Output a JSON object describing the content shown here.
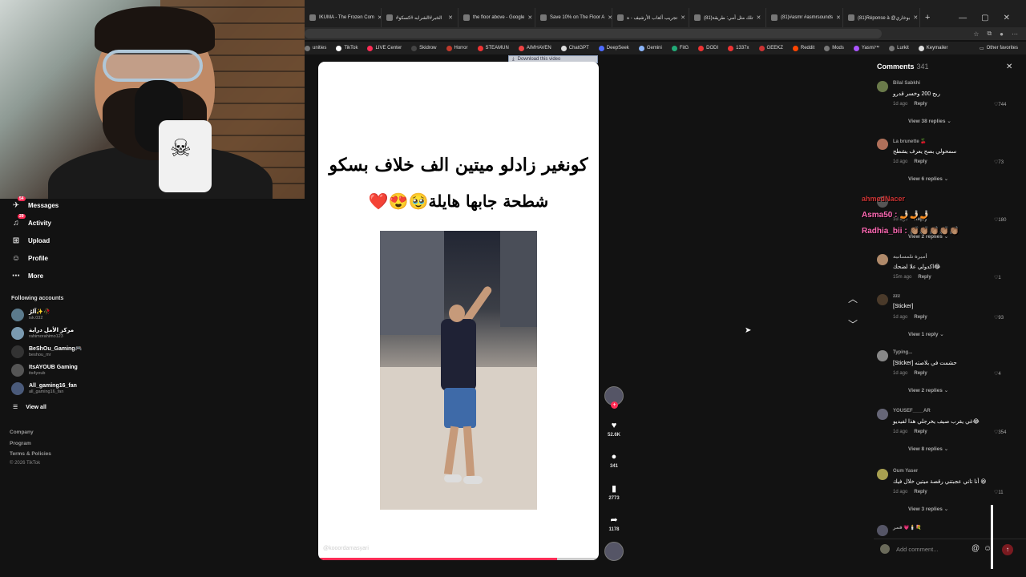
{
  "browser": {
    "tabs": [
      {
        "title": "IKUMA - The Frozen Com"
      },
      {
        "title": "#الخبر#الشرابه #كسكو"
      },
      {
        "title": "the floor above - Google"
      },
      {
        "title": "Save 10% on The Floor A"
      },
      {
        "title": "تجريب ألعاب الأرشيف - ه"
      },
      {
        "title": "(81)تلك مثل أمي: طريقة"
      },
      {
        "title": "(81)#asmr #asmrsounds"
      },
      {
        "title": "(81)Réponse à @بوخاري"
      }
    ],
    "window_controls": [
      "—",
      "▢",
      "✕"
    ],
    "bookmarks": [
      {
        "label": "unities",
        "color": "#777"
      },
      {
        "label": "TikTok",
        "color": "#fff"
      },
      {
        "label": "LIVE Center",
        "color": "#fe2c55"
      },
      {
        "label": "Skidrow",
        "color": "#444"
      },
      {
        "label": "Horror",
        "color": "#c0392b"
      },
      {
        "label": "STEAMUN",
        "color": "#e33"
      },
      {
        "label": "AIMHAVEN",
        "color": "#e44"
      },
      {
        "label": "ChatGPT",
        "color": "#ddd"
      },
      {
        "label": "DeepSeek",
        "color": "#4d6bfe"
      },
      {
        "label": "Gemini",
        "color": "#8ab4f8"
      },
      {
        "label": "FitG",
        "color": "#2a7"
      },
      {
        "label": "DODI",
        "color": "#e33"
      },
      {
        "label": "1337x",
        "color": "#e33"
      },
      {
        "label": "GEEKZ",
        "color": "#c33"
      },
      {
        "label": "Reddit",
        "color": "#ff4500"
      },
      {
        "label": "Mods",
        "color": "#777"
      },
      {
        "label": "Yasmi™",
        "color": "#a5f"
      },
      {
        "label": "Lurkit",
        "color": "#777"
      },
      {
        "label": "Keymailer",
        "color": "#ddd"
      }
    ],
    "other_favorites": "Other favorites"
  },
  "sidebar": {
    "nav": [
      {
        "label": "Messages",
        "icon": "paper-plane-icon",
        "glyph": "✈",
        "badge": "54"
      },
      {
        "label": "Activity",
        "icon": "bell-icon",
        "glyph": "♫",
        "badge": "29"
      },
      {
        "label": "Upload",
        "icon": "upload-icon",
        "glyph": "⊞",
        "badge": ""
      },
      {
        "label": "Profile",
        "icon": "profile-icon",
        "glyph": "☺",
        "badge": ""
      },
      {
        "label": "More",
        "icon": "more-icon",
        "glyph": "⋯",
        "badge": ""
      }
    ],
    "following_title": "Following accounts",
    "accounts": [
      {
        "name": "آلرُ✨🥀",
        "handle": "isk.032",
        "color": "#5b7a8c"
      },
      {
        "name": "مركز الأمل دراية",
        "handle": "rahimorahimo123",
        "color": "#7a9ab0"
      },
      {
        "name": "BeShOu_Gaming🎮",
        "handle": "beshou_mr",
        "color": "#333"
      },
      {
        "name": "ItsAYOUB Gaming",
        "handle": "its4youb",
        "color": "#555"
      },
      {
        "name": "All_gaming16_fan",
        "handle": "all_gaming16_fan",
        "color": "#4a5a7a"
      }
    ],
    "view_all": "View all",
    "footer": [
      "Company",
      "Program",
      "Terms & Policies"
    ],
    "copyright": "© 2026 TikTok"
  },
  "video": {
    "download_chip": "Download this video",
    "caption_line1": "كونغير زادلو ميتين الف خلاف بسكو",
    "caption_line2": "شطحة جابها هايلة🥹😍❤️",
    "watermark": "@kooordamasyari",
    "progress": 0.85
  },
  "actions": {
    "likes": "52.6K",
    "comments": "341",
    "saves": "2773",
    "shares": "1178"
  },
  "comments": {
    "title": "Comments",
    "count": "341",
    "items": [
      {
        "user": "Bilal Sabkhi",
        "text": "ربح 200 وخسر قدرو",
        "time": "1d ago",
        "likes": "744",
        "view_replies": "View 38 replies",
        "color": "#6a7a4a"
      },
      {
        "user": "La brunette 🍒",
        "text": "سمحولي بصح يعرف يشطح",
        "time": "1d ago",
        "likes": "73",
        "view_replies": "View 6 replies",
        "color": "#b0705a"
      },
      {
        "user": "",
        "text": "",
        "time": "1d ago",
        "likes": "180",
        "view_replies": "View 2 replies",
        "color": "#555"
      },
      {
        "user": "أميرة تلمسانية",
        "text": "اكدولي علا لضحك😂",
        "time": "15m ago",
        "likes": "1",
        "view_replies": "",
        "color": "#b08a6a"
      },
      {
        "user": "zzz",
        "text": "[Sticker]",
        "time": "1d ago",
        "likes": "93",
        "view_replies": "View 1 reply",
        "color": "#4a3a2a"
      },
      {
        "user": "Typing...",
        "text": "[Sticker] حشمت في بلاصته",
        "time": "1d ago",
        "likes": "4",
        "view_replies": "View 2 replies",
        "color": "#888"
      },
      {
        "user": "YOUSEF____AR",
        "text": "غي يقرب صيف يخرجلي هذا لفيديو😂",
        "time": "1d ago",
        "likes": "354",
        "view_replies": "View 8 replies",
        "color": "#667"
      },
      {
        "user": "Oum Yaser",
        "text": "أنا تاني عجبتني رقصة ميتين خلال فيك 😆",
        "time": "1d ago",
        "likes": "11",
        "view_replies": "View 3 replies",
        "color": "#a8a050"
      },
      {
        "user": "قمر 💗🕯️💐",
        "text": "",
        "time": "",
        "likes": "",
        "view_replies": "",
        "color": "#556"
      }
    ],
    "reply_label": "Reply",
    "overlay_chat": [
      "Asma50 : 🤳🏻🤳🏻🤳🏻",
      "Radhia_bii : 👏🏽👏🏽👏🏽👏🏽👏🏽",
      "ahmedNacer"
    ],
    "add_placeholder": "Add comment...",
    "at_symbol": "@",
    "emoji_symbol": "☺"
  }
}
